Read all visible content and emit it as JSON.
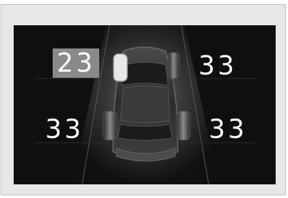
{
  "tpms": {
    "front_left": {
      "value": "23",
      "status": "low"
    },
    "front_right": {
      "value": "33",
      "status": "normal"
    },
    "rear_left": {
      "value": "33",
      "status": "normal"
    },
    "rear_right": {
      "value": "33",
      "status": "normal"
    }
  },
  "colors": {
    "screen_background": "#0f0f0f",
    "warning_highlight": "#8a8a8a",
    "text": "#ffffff"
  }
}
